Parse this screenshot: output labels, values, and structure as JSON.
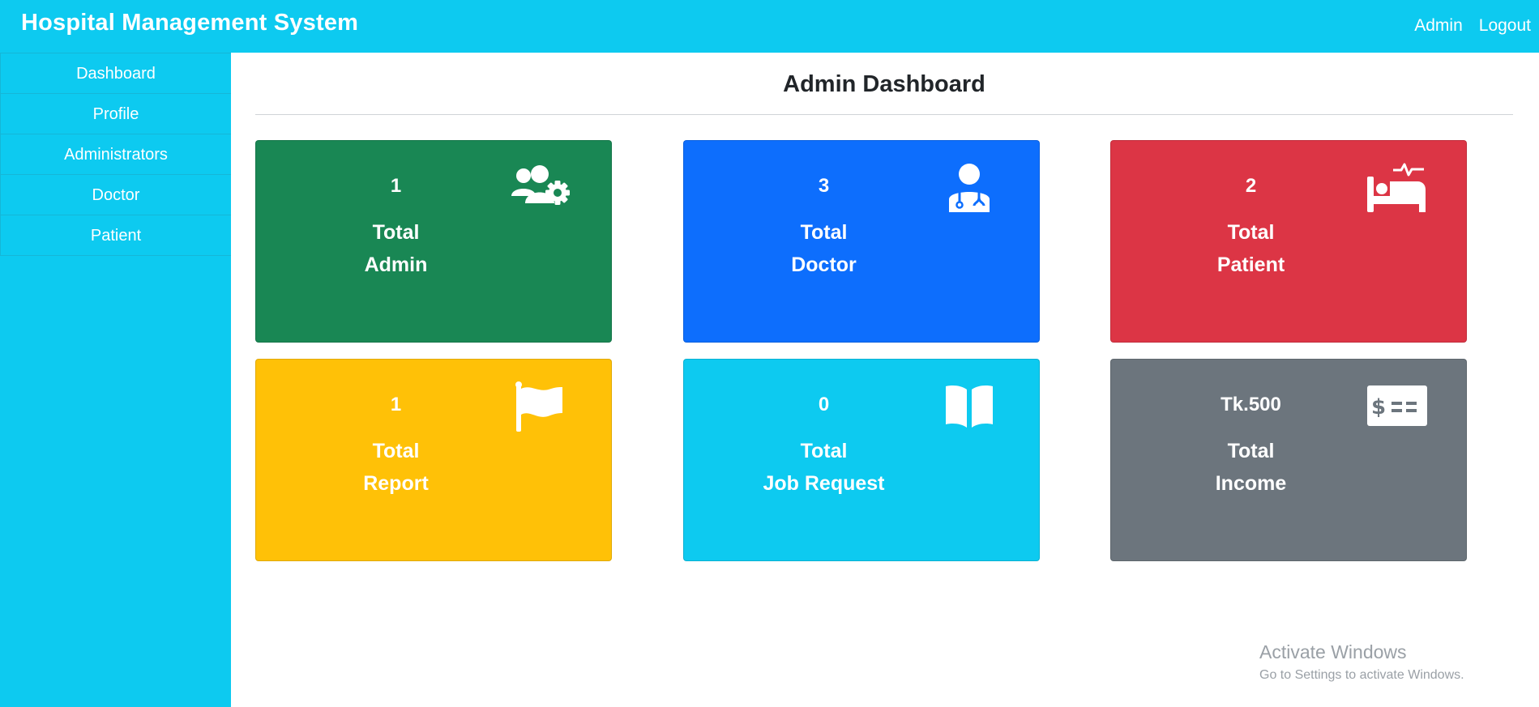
{
  "app": {
    "title": "Hospital Management System",
    "nav": {
      "admin": "Admin",
      "logout": "Logout"
    }
  },
  "sidebar": {
    "items": [
      {
        "label": "Dashboard"
      },
      {
        "label": "Profile"
      },
      {
        "label": "Administrators"
      },
      {
        "label": "Doctor"
      },
      {
        "label": "Patient"
      }
    ]
  },
  "main": {
    "title": "Admin Dashboard",
    "cards": [
      {
        "count": "1",
        "line1": "Total",
        "line2": "Admin",
        "color": "#198754",
        "icon": "users-gear-icon"
      },
      {
        "count": "3",
        "line1": "Total",
        "line2": "Doctor",
        "color": "#0d6efd",
        "icon": "doctor-icon"
      },
      {
        "count": "2",
        "line1": "Total",
        "line2": "Patient",
        "color": "#dc3545",
        "icon": "hospital-bed-icon"
      },
      {
        "count": "1",
        "line1": "Total",
        "line2": "Report",
        "color": "#ffc107",
        "icon": "flag-icon"
      },
      {
        "count": "0",
        "line1": "Total",
        "line2": "Job Request",
        "color": "#0dcaf0",
        "icon": "open-book-icon"
      },
      {
        "count": "Tk.500",
        "line1": "Total",
        "line2": "Income",
        "color": "#6c757d",
        "icon": "money-check-icon"
      }
    ]
  },
  "watermark": {
    "title": "Activate Windows",
    "subtitle": "Go to Settings to activate Windows."
  }
}
